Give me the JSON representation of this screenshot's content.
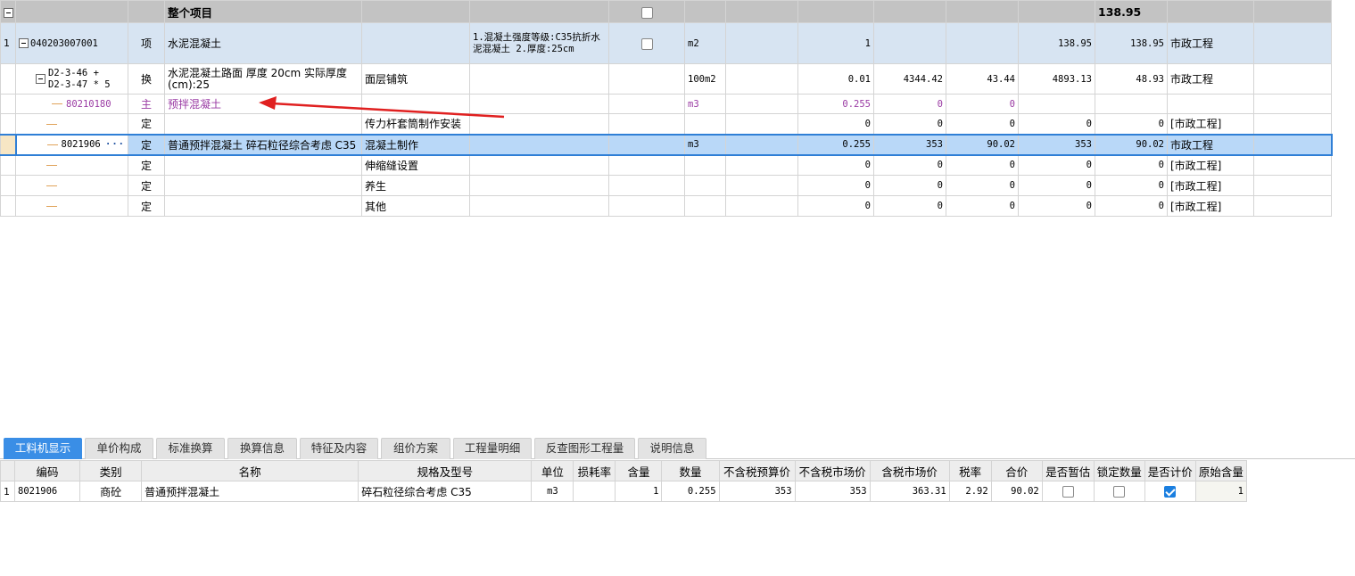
{
  "upper": {
    "total_row": {
      "label": "整个项目",
      "total": "138.95"
    },
    "section": {
      "rownum": "1",
      "code": "040203007001",
      "type": "项",
      "name": "水泥混凝土",
      "features": "1.混凝土强度等级:C35抗折水泥混凝土\n2.厚度:25cm",
      "unit": "m2",
      "qty": "1",
      "comp_price": "138.95",
      "comp_total": "138.95",
      "specialty": "市政工程"
    },
    "sub_row": {
      "code_line1": "D2-3-46 +",
      "code_line2": "D2-3-47 * 5",
      "type": "换",
      "name": "水泥混凝土路面 厚度 20cm  实际厚度(cm):25",
      "content": "面层铺筑",
      "unit": "100m2",
      "qty": "0.01",
      "price": "4344.42",
      "total": "43.44",
      "comp_price": "4893.13",
      "comp_total": "48.93",
      "specialty": "市政工程"
    },
    "main_row": {
      "code": "80210180",
      "type": "主",
      "name": "预拌混凝土",
      "unit": "m3",
      "qty": "0.255",
      "price": "0",
      "total": "0"
    },
    "rows": [
      {
        "type": "定",
        "content": "传力杆套筒制作安装",
        "qty": "0",
        "price": "0",
        "total": "0",
        "comp_price": "0",
        "comp_total": "0",
        "specialty": "[市政工程]"
      }
    ],
    "selected_row": {
      "code": "8021906",
      "dots": "···",
      "type": "定",
      "name": "普通预拌混凝土 碎石粒径综合考虑 C35",
      "content": "混凝土制作",
      "unit": "m3",
      "qty": "0.255",
      "price": "353",
      "total": "90.02",
      "comp_price": "353",
      "comp_total": "90.02",
      "specialty": "市政工程"
    },
    "rows_after": [
      {
        "type": "定",
        "content": "伸缩缝设置",
        "qty": "0",
        "price": "0",
        "total": "0",
        "comp_price": "0",
        "comp_total": "0",
        "specialty": "[市政工程]"
      },
      {
        "type": "定",
        "content": "养生",
        "qty": "0",
        "price": "0",
        "total": "0",
        "comp_price": "0",
        "comp_total": "0",
        "specialty": "[市政工程]"
      },
      {
        "type": "定",
        "content": "其他",
        "qty": "0",
        "price": "0",
        "total": "0",
        "comp_price": "0",
        "comp_total": "0",
        "specialty": "[市政工程]"
      }
    ]
  },
  "tabs": [
    "工料机显示",
    "单价构成",
    "标准换算",
    "换算信息",
    "特征及内容",
    "组价方案",
    "工程量明细",
    "反查图形工程量",
    "说明信息"
  ],
  "lower": {
    "headers": [
      "编码",
      "类别",
      "名称",
      "规格及型号",
      "单位",
      "损耗率",
      "含量",
      "数量",
      "不含税预算价",
      "不含税市场价",
      "含税市场价",
      "税率",
      "合价",
      "是否暂估",
      "锁定数量",
      "是否计价",
      "原始含量"
    ],
    "row": {
      "rownum": "1",
      "code": "8021906",
      "category": "商砼",
      "name": "普通预拌混凝土",
      "spec": "碎石粒径综合考虑 C35",
      "unit": "m3",
      "loss_rate": "",
      "content_qty": "1",
      "qty": "0.255",
      "budget_price": "353",
      "market_price": "353",
      "tax_market_price": "363.31",
      "tax_rate": "2.92",
      "total": "90.02",
      "is_estimate": false,
      "lock_qty": false,
      "is_priced": true,
      "orig_content": "1"
    }
  },
  "colors": {
    "accent": "#3a8ee6",
    "selected_bg": "#b9d8f8",
    "section_bg": "#d7e4f2",
    "main_text": "#9a3aa3",
    "arrow": "#e02020"
  }
}
